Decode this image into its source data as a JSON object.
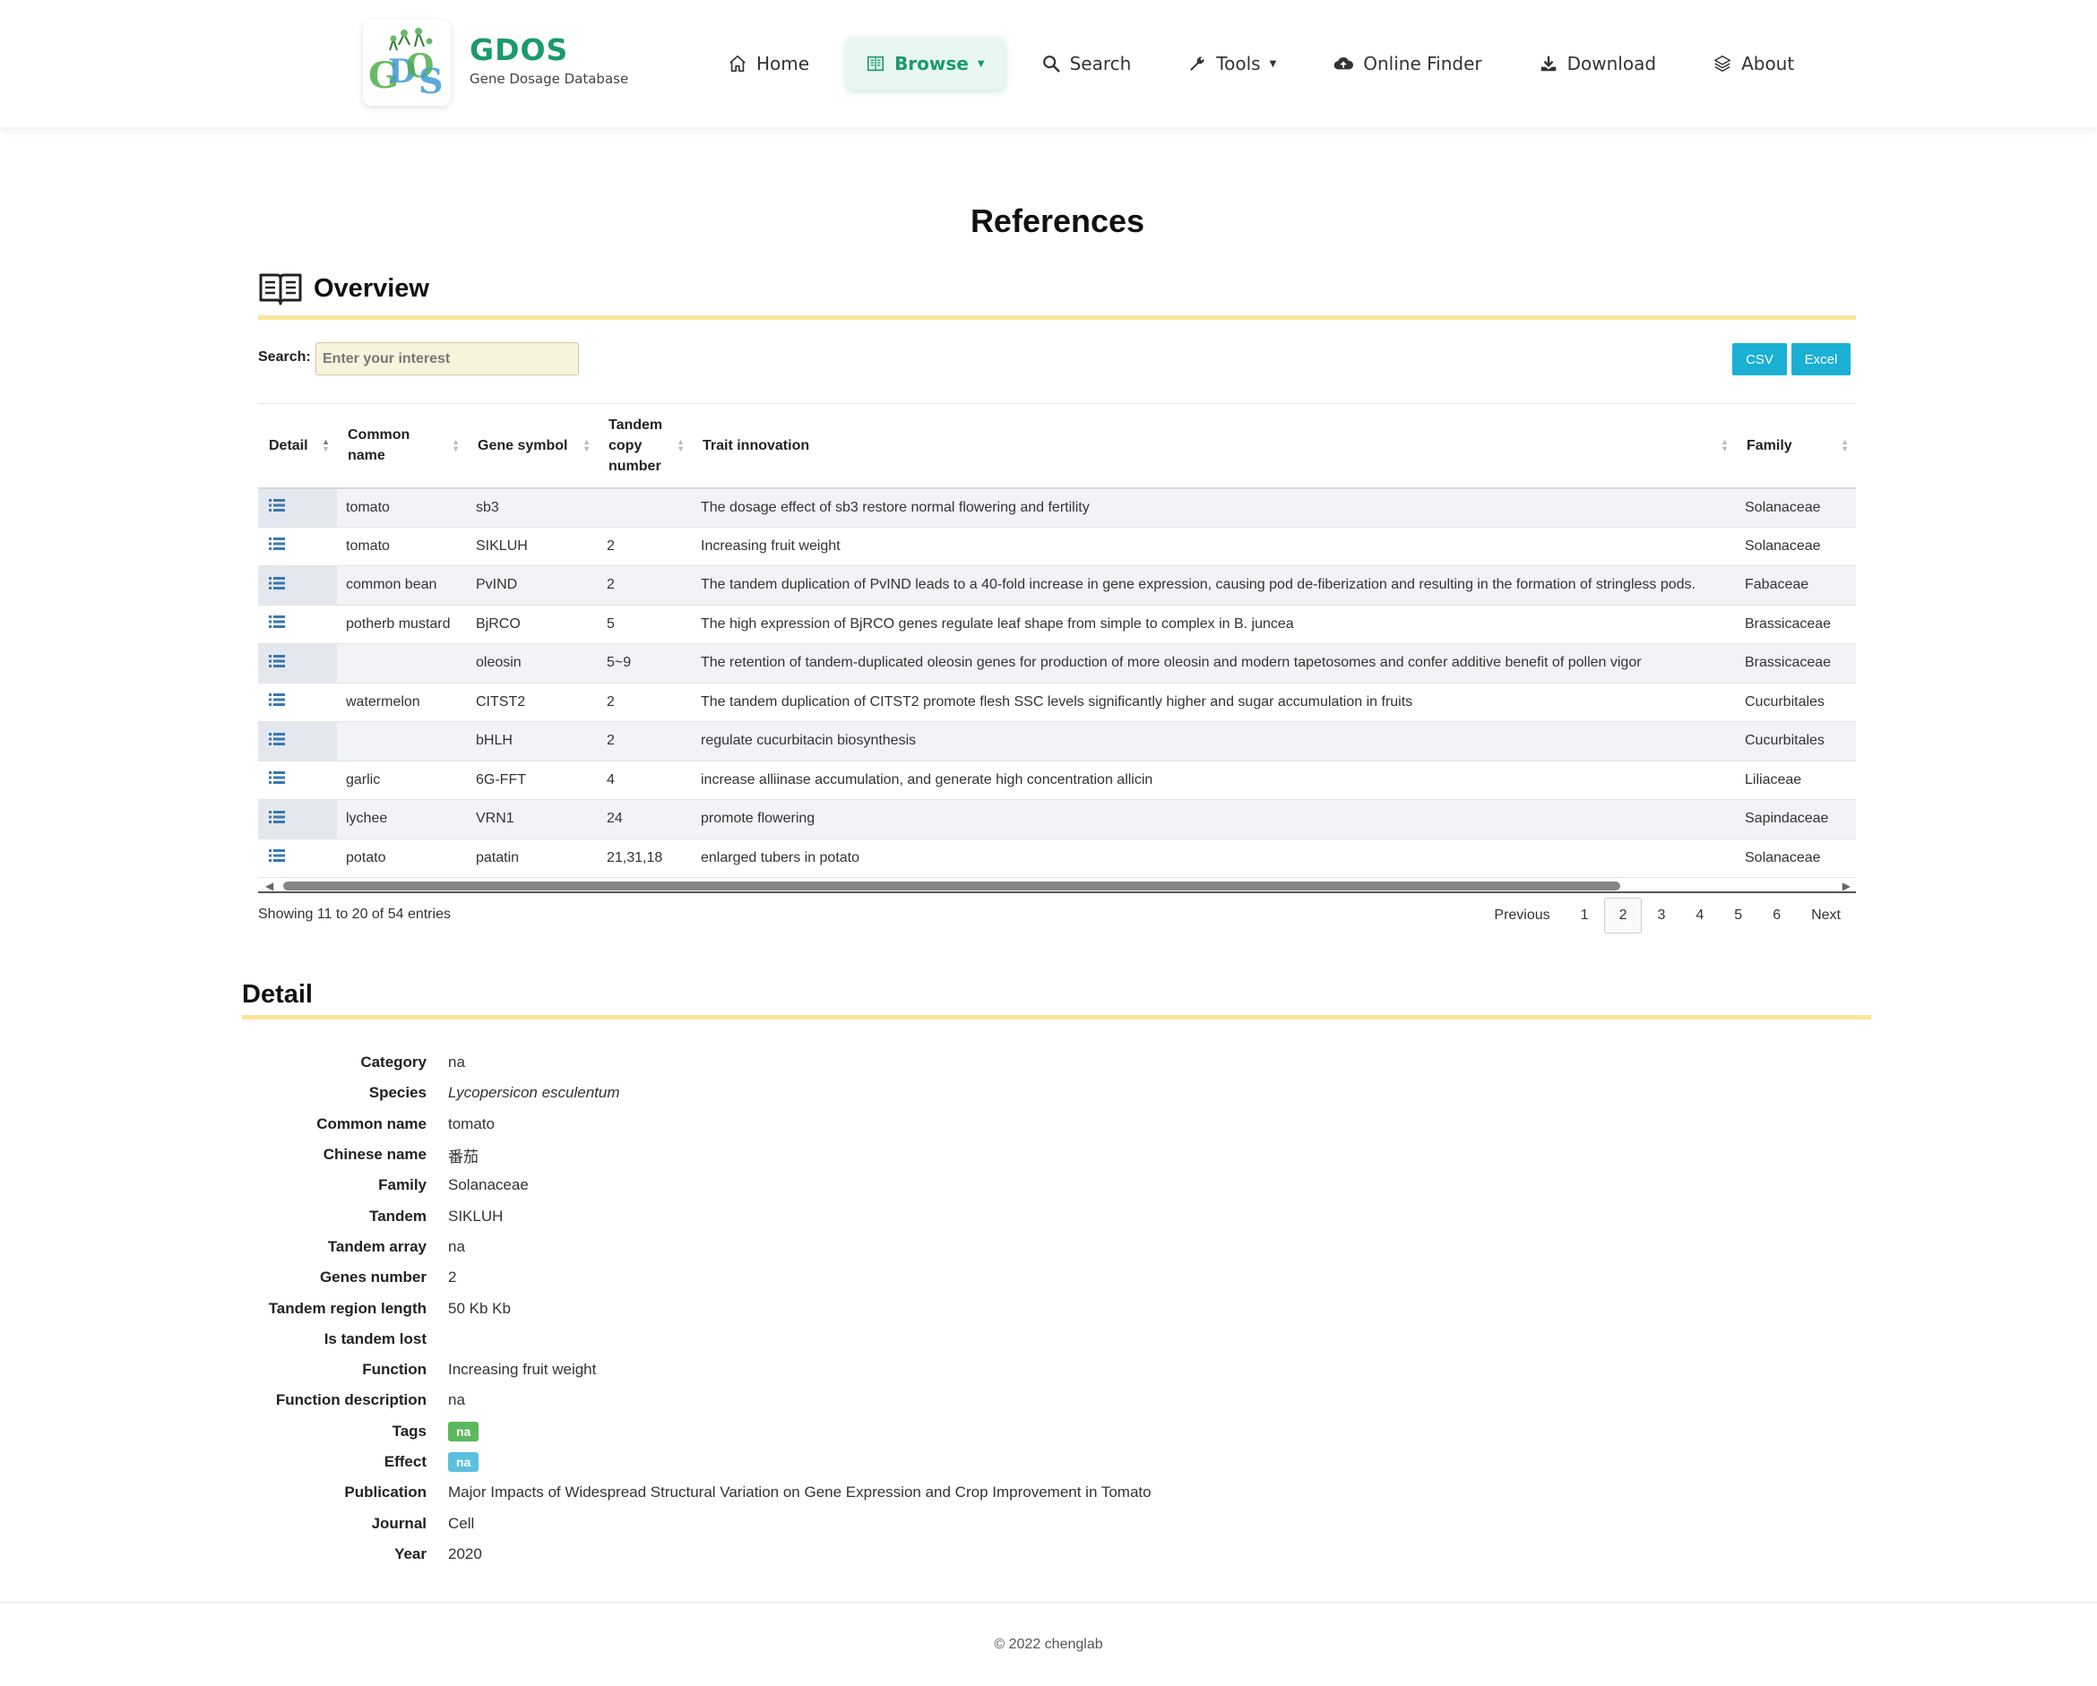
{
  "header": {
    "logo_title": "GDOS",
    "logo_subtitle": "Gene Dosage Database",
    "nav": [
      {
        "label": "Home",
        "icon": "home-icon"
      },
      {
        "label": "Browse",
        "icon": "book-icon",
        "active": true,
        "dropdown": true
      },
      {
        "label": "Search",
        "icon": "search-icon"
      },
      {
        "label": "Tools",
        "icon": "wrench-icon",
        "dropdown": true
      },
      {
        "label": "Online Finder",
        "icon": "cloud-upload-icon"
      },
      {
        "label": "Download",
        "icon": "download-icon"
      },
      {
        "label": "About",
        "icon": "layers-icon"
      }
    ]
  },
  "page_title": "References",
  "overview": {
    "title": "Overview",
    "search_label": "Search:",
    "search_placeholder": "Enter your interest",
    "csv_label": "CSV",
    "excel_label": "Excel",
    "columns": [
      "Detail",
      "Common name",
      "Gene symbol",
      "Tandem copy number",
      "Trait innovation",
      "Family"
    ],
    "rows": [
      {
        "common": "tomato",
        "gene": "sb3",
        "copies": "",
        "trait": "The dosage effect of sb3 restore normal flowering and fertility",
        "family": "Solanaceae"
      },
      {
        "common": "tomato",
        "gene": "SIKLUH",
        "copies": "2",
        "trait": "Increasing fruit weight",
        "family": "Solanaceae"
      },
      {
        "common": "common bean",
        "gene": "PvIND",
        "copies": "2",
        "trait": "The tandem duplication of PvIND leads to a 40-fold increase in gene expression, causing pod de-fiberization and resulting in the formation of stringless pods.",
        "family": "Fabaceae"
      },
      {
        "common": "potherb mustard",
        "gene": "BjRCO",
        "copies": "5",
        "trait": "The high expression of BjRCO genes regulate leaf shape from simple to complex in B. juncea",
        "family": "Brassicaceae"
      },
      {
        "common": "",
        "gene": "oleosin",
        "copies": "5~9",
        "trait": "The retention of tandem-duplicated oleosin genes for production of more oleosin and modern tapetosomes and confer additive benefit of pollen vigor",
        "family": "Brassicaceae"
      },
      {
        "common": "watermelon",
        "gene": "CITST2",
        "copies": "2",
        "trait": "The tandem duplication of CITST2 promote flesh SSC levels significantly higher and sugar accumulation in fruits",
        "family": "Cucurbitales"
      },
      {
        "common": "",
        "gene": "bHLH",
        "copies": "2",
        "trait": "regulate cucurbitacin biosynthesis",
        "family": "Cucurbitales"
      },
      {
        "common": "garlic",
        "gene": "6G-FFT",
        "copies": "4",
        "trait": "increase alliinase accumulation, and generate high concentration allicin",
        "family": "Liliaceae"
      },
      {
        "common": "lychee",
        "gene": "VRN1",
        "copies": "24",
        "trait": "promote flowering",
        "family": "Sapindaceae"
      },
      {
        "common": "potato",
        "gene": "patatin",
        "copies": "21,31,18",
        "trait": "enlarged tubers in potato",
        "family": "Solanaceae"
      }
    ],
    "info": "Showing 11 to 20 of 54 entries",
    "pagination": {
      "previous": "Previous",
      "next": "Next",
      "pages": [
        "1",
        "2",
        "3",
        "4",
        "5",
        "6"
      ],
      "current": "2"
    }
  },
  "detail": {
    "title": "Detail",
    "fields": [
      {
        "k": "Category",
        "v": "na"
      },
      {
        "k": "Species",
        "v": "Lycopersicon esculentum",
        "italic": true
      },
      {
        "k": "Common name",
        "v": "tomato"
      },
      {
        "k": "Chinese name",
        "v": "番茄"
      },
      {
        "k": "Family",
        "v": "Solanaceae"
      },
      {
        "k": "Tandem",
        "v": "SIKLUH"
      },
      {
        "k": "Tandem array",
        "v": "na"
      },
      {
        "k": "Genes number",
        "v": "2"
      },
      {
        "k": "Tandem region length",
        "v": "50 Kb Kb"
      },
      {
        "k": "Is tandem lost",
        "v": ""
      },
      {
        "k": "Function",
        "v": "Increasing fruit weight"
      },
      {
        "k": "Function description",
        "v": "na"
      },
      {
        "k": "Tags",
        "v": "na",
        "badge": "#5cb85c"
      },
      {
        "k": "Effect",
        "v": "na",
        "badge": "#5bc0de"
      },
      {
        "k": "Publication",
        "v": "Major Impacts of Widespread Structural Variation on Gene Expression and Crop Improvement in Tomato",
        "link": true
      },
      {
        "k": "Journal",
        "v": "Cell"
      },
      {
        "k": "Year",
        "v": "2020"
      }
    ]
  },
  "footer": "© 2022 chenglab",
  "colors": {
    "brand": "#1a9a6c",
    "accent_rule": "#fbe49a",
    "button": "#1ab0d3",
    "link": "#337ab7"
  }
}
